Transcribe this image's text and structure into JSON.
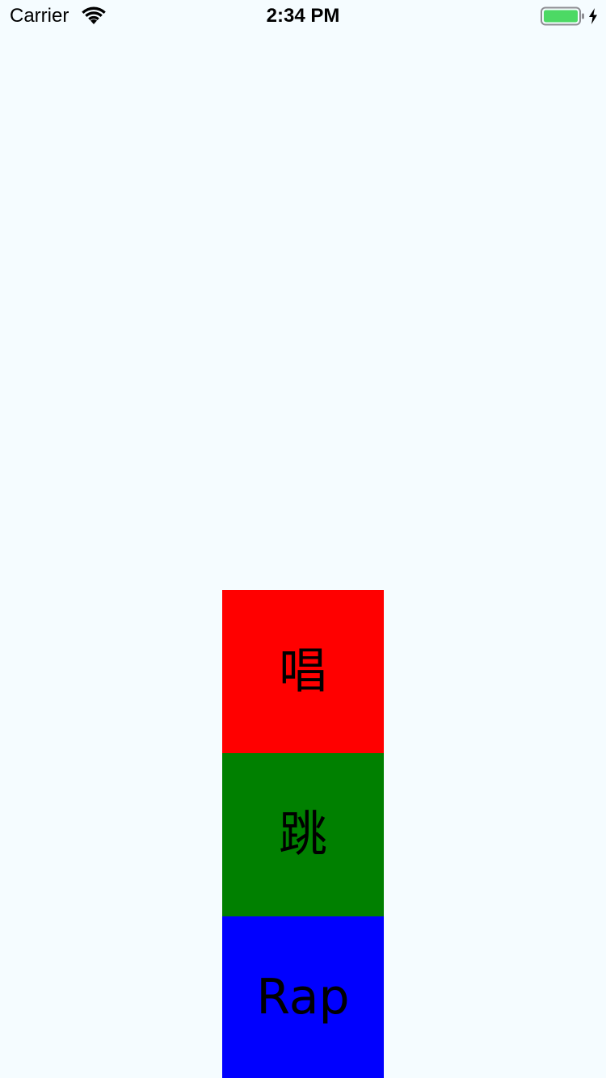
{
  "status_bar": {
    "carrier": "Carrier",
    "time": "2:34 PM",
    "wifi_icon": "wifi-icon",
    "battery_icon": "battery-icon",
    "charging_icon": "bolt-icon",
    "battery_color": "#4cd964"
  },
  "tiles": [
    {
      "label": "唱",
      "color": "#ff0000"
    },
    {
      "label": "跳",
      "color": "#008000"
    },
    {
      "label": "Rap",
      "color": "#0000ff"
    }
  ],
  "background_color": "#f5fcff"
}
